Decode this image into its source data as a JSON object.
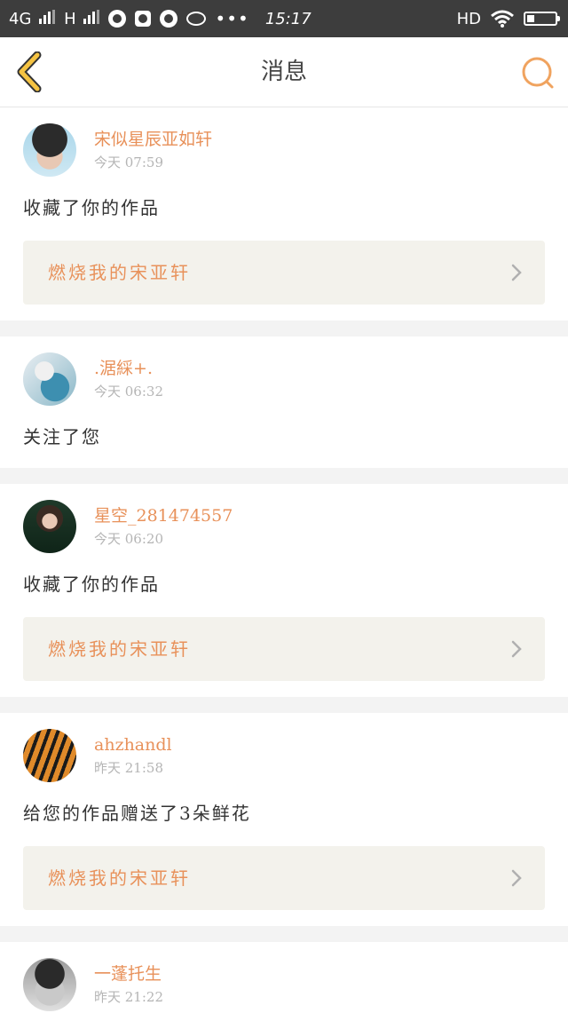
{
  "status_bar": {
    "network1": "4G",
    "network2": "H",
    "more": "•••",
    "time": "15:17",
    "hd": "HD"
  },
  "header": {
    "title": "消息"
  },
  "colors": {
    "accent": "#e8915a",
    "status_bar_bg": "#3d3d3d",
    "card_bg": "#f3f2ec"
  },
  "notifications": [
    {
      "username": "宋似星辰亚如轩",
      "time": "今天  07:59",
      "action": "收藏了你的作品",
      "work_title": "燃烧我的宋亚轩"
    },
    {
      "username": ".涺綵+.",
      "time": "今天  06:32",
      "action": "关注了您",
      "work_title": ""
    },
    {
      "username": "星空_281474557",
      "time": "今天  06:20",
      "action": "收藏了你的作品",
      "work_title": "燃烧我的宋亚轩"
    },
    {
      "username": "ahzhandl",
      "time": "昨天  21:58",
      "action": "给您的作品赠送了3朵鲜花",
      "work_title": "燃烧我的宋亚轩"
    },
    {
      "username": "一蓬托生",
      "time": "昨天  21:22",
      "action": "",
      "work_title": ""
    }
  ]
}
